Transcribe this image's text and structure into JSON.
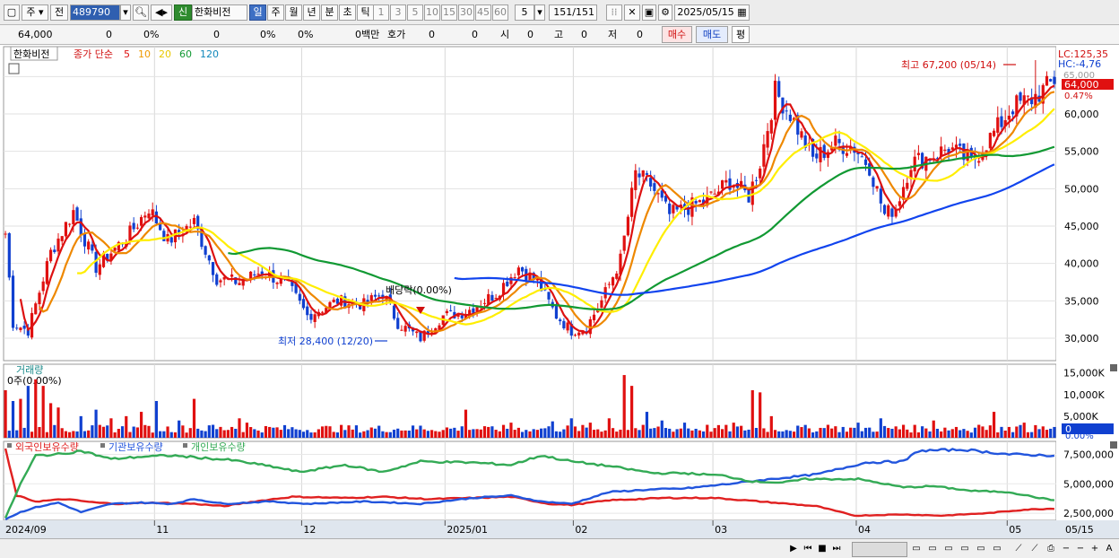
{
  "toolbar": {
    "period_week": "주",
    "prev": "전",
    "code": "489790",
    "credit": "신",
    "stock_name": "한화비전",
    "tabs": [
      "일",
      "주",
      "월",
      "년",
      "분",
      "초",
      "틱"
    ],
    "active_tab": "일",
    "intervals": [
      "1",
      "3",
      "5",
      "10",
      "15",
      "30",
      "45",
      "60"
    ],
    "count": "5",
    "range": "151",
    "range_total": "/151",
    "date": "2025/05/15"
  },
  "quote": {
    "price": "64,000",
    "change": "0",
    "change_pct": "0%",
    "volume": "0",
    "v2": "0%",
    "v3": "0%",
    "amount": "0백만",
    "hoga_label": "호가",
    "hoga_val": "0",
    "hoga_val2": "0",
    "si_label": "시",
    "si_val": "0",
    "go_label": "고",
    "go_val": "0",
    "jeo_label": "저",
    "jeo_val": "0",
    "buy": "매수",
    "sell": "매도",
    "pyeong": "평"
  },
  "chart_data": [
    {
      "type": "candlestick",
      "title": "한화비전",
      "legend_prefix": "종가 단순",
      "ma_periods": [
        5,
        10,
        20,
        60,
        120
      ],
      "ma_colors": [
        "#dd1111",
        "#ee8800",
        "#ffee00",
        "#119933",
        "#1144ee"
      ],
      "ma_legend_colors": [
        "#dd1111",
        "#ee9900",
        "#e8c800",
        "#119933",
        "#1188bb"
      ],
      "ylim": [
        27000,
        69000
      ],
      "yticks": [
        "30,000",
        "35,000",
        "40,000",
        "45,000",
        "50,000",
        "55,000",
        "60,000",
        "65,000"
      ],
      "ytick_values": [
        30000,
        35000,
        40000,
        45000,
        50000,
        55000,
        60000,
        65000
      ],
      "x_labels": [
        "2024/09",
        "11",
        "12",
        "2025/01",
        "02",
        "03",
        "04",
        "05",
        "05/15"
      ],
      "x_label_index": [
        0,
        40,
        79,
        117,
        151,
        188,
        226,
        266,
        289
      ],
      "n_bars": 279,
      "close_path": [
        [
          0,
          44000
        ],
        [
          2,
          32000
        ],
        [
          6,
          31000
        ],
        [
          12,
          41500
        ],
        [
          18,
          47000
        ],
        [
          24,
          39500
        ],
        [
          28,
          41500
        ],
        [
          33,
          44000
        ],
        [
          38,
          47500
        ],
        [
          43,
          43000
        ],
        [
          50,
          45500
        ],
        [
          56,
          38000
        ],
        [
          62,
          37500
        ],
        [
          68,
          39000
        ],
        [
          75,
          37000
        ],
        [
          80,
          33000
        ],
        [
          88,
          35000
        ],
        [
          95,
          34500
        ],
        [
          100,
          36000
        ],
        [
          104,
          32000
        ],
        [
          110,
          30000
        ],
        [
          116,
          33000
        ],
        [
          122,
          33500
        ],
        [
          130,
          36000
        ],
        [
          136,
          39500
        ],
        [
          141,
          37500
        ],
        [
          146,
          33000
        ],
        [
          150,
          31000
        ],
        [
          154,
          31500
        ],
        [
          158,
          35000
        ],
        [
          163,
          40500
        ],
        [
          167,
          52000
        ],
        [
          171,
          50500
        ],
        [
          176,
          46500
        ],
        [
          181,
          47500
        ],
        [
          186,
          48500
        ],
        [
          192,
          51000
        ],
        [
          197,
          49000
        ],
        [
          200,
          53500
        ],
        [
          204,
          63000
        ],
        [
          208,
          60000
        ],
        [
          214,
          54000
        ],
        [
          220,
          56000
        ],
        [
          225,
          55500
        ],
        [
          229,
          53000
        ],
        [
          233,
          46500
        ],
        [
          236,
          47500
        ],
        [
          240,
          53500
        ],
        [
          246,
          54500
        ],
        [
          250,
          55500
        ],
        [
          256,
          53500
        ],
        [
          262,
          57500
        ],
        [
          267,
          61000
        ],
        [
          272,
          62000
        ],
        [
          277,
          64000
        ],
        [
          278,
          64000
        ]
      ],
      "last_close": 64000,
      "high": {
        "label": "최고 67,200 (05/14)",
        "value": 67200
      },
      "low": {
        "label": "최저 28,400 (12/20)",
        "value": 28400
      },
      "event": {
        "label": "배당락(0.00%)"
      },
      "right_labels": {
        "lc": "LC:125,35",
        "hc": "HC:-4,76",
        "top": "65,000",
        "price": "64,000",
        "pct": "0.47%"
      }
    },
    {
      "type": "bar",
      "title": "거래량",
      "subtitle": "0주(0.00%)",
      "yticks": [
        "15,000K",
        "10,000K",
        "5,000K",
        "0"
      ],
      "ytick_values": [
        15000,
        10000,
        5000,
        0
      ],
      "bottom_label": "0.00%",
      "ylim": [
        0,
        17000
      ],
      "unit": "K",
      "spikes": [
        [
          0,
          11000
        ],
        [
          2,
          8500
        ],
        [
          4,
          9000
        ],
        [
          6,
          12000
        ],
        [
          8,
          13500
        ],
        [
          10,
          12000
        ],
        [
          12,
          8000
        ],
        [
          14,
          7000
        ],
        [
          20,
          5000
        ],
        [
          24,
          6500
        ],
        [
          28,
          4500
        ],
        [
          32,
          5000
        ],
        [
          36,
          6000
        ],
        [
          40,
          8500
        ],
        [
          46,
          4000
        ],
        [
          50,
          9000
        ],
        [
          55,
          3000
        ],
        [
          60,
          2500
        ],
        [
          62,
          4500
        ],
        [
          64,
          3500
        ],
        [
          70,
          2500
        ],
        [
          75,
          2000
        ],
        [
          80,
          1800
        ],
        [
          95,
          1500
        ],
        [
          100,
          1500
        ],
        [
          110,
          2800
        ],
        [
          116,
          1800
        ],
        [
          122,
          6500
        ],
        [
          128,
          2500
        ],
        [
          134,
          3500
        ],
        [
          140,
          2000
        ],
        [
          145,
          3800
        ],
        [
          150,
          4500
        ],
        [
          155,
          3500
        ],
        [
          160,
          4500
        ],
        [
          164,
          14500
        ],
        [
          166,
          12000
        ],
        [
          170,
          6000
        ],
        [
          174,
          4000
        ],
        [
          180,
          3500
        ],
        [
          186,
          3000
        ],
        [
          193,
          3500
        ],
        [
          198,
          11000
        ],
        [
          200,
          10500
        ],
        [
          203,
          5000
        ],
        [
          210,
          2800
        ],
        [
          218,
          3000
        ],
        [
          226,
          3500
        ],
        [
          232,
          4500
        ],
        [
          238,
          3000
        ],
        [
          246,
          4000
        ],
        [
          252,
          2500
        ],
        [
          258,
          3000
        ],
        [
          262,
          6000
        ],
        [
          266,
          2500
        ],
        [
          270,
          3500
        ],
        [
          274,
          2000
        ],
        [
          278,
          2500
        ]
      ]
    },
    {
      "type": "line",
      "title": "외국인보유수량",
      "series": [
        {
          "name": "외국인보유수량",
          "color": "#e02020",
          "values": [
            [
              0,
              7900000
            ],
            [
              3,
              4000000
            ],
            [
              8,
              3500000
            ],
            [
              16,
              3700000
            ],
            [
              24,
              3400000
            ],
            [
              30,
              3300000
            ],
            [
              38,
              3400000
            ],
            [
              50,
              3300000
            ],
            [
              58,
              3100000
            ],
            [
              66,
              3500000
            ],
            [
              76,
              3900000
            ],
            [
              90,
              3800000
            ],
            [
              100,
              3900000
            ],
            [
              112,
              3700000
            ],
            [
              124,
              3800000
            ],
            [
              134,
              3900000
            ],
            [
              144,
              3300000
            ],
            [
              150,
              3200000
            ],
            [
              160,
              3600000
            ],
            [
              175,
              3800000
            ],
            [
              188,
              3800000
            ],
            [
              200,
              3500000
            ],
            [
              215,
              3100000
            ],
            [
              225,
              2300000
            ],
            [
              238,
              2400000
            ],
            [
              248,
              2300000
            ],
            [
              260,
              2500000
            ],
            [
              270,
              2800000
            ],
            [
              278,
              2900000
            ]
          ]
        },
        {
          "name": "기관보유수량",
          "color": "#2255dd",
          "values": [
            [
              0,
              2000000
            ],
            [
              4,
              2600000
            ],
            [
              8,
              3000000
            ],
            [
              14,
              3400000
            ],
            [
              20,
              2600000
            ],
            [
              28,
              3300000
            ],
            [
              36,
              3400000
            ],
            [
              44,
              3300000
            ],
            [
              50,
              3700000
            ],
            [
              58,
              3300000
            ],
            [
              70,
              3500000
            ],
            [
              80,
              3300000
            ],
            [
              95,
              3500000
            ],
            [
              110,
              3300000
            ],
            [
              124,
              3800000
            ],
            [
              134,
              4000000
            ],
            [
              142,
              3500000
            ],
            [
              150,
              3300000
            ],
            [
              160,
              4300000
            ],
            [
              170,
              4500000
            ],
            [
              180,
              4600000
            ],
            [
              192,
              5000000
            ],
            [
              200,
              5300000
            ],
            [
              215,
              5800000
            ],
            [
              228,
              6800000
            ],
            [
              238,
              6900000
            ],
            [
              242,
              7800000
            ],
            [
              254,
              7900000
            ],
            [
              266,
              7500000
            ],
            [
              278,
              7400000
            ]
          ]
        },
        {
          "name": "개인보유수량",
          "color": "#33aa55",
          "values": [
            [
              0,
              2100000
            ],
            [
              4,
              5000000
            ],
            [
              8,
              7400000
            ],
            [
              14,
              7500000
            ],
            [
              20,
              7800000
            ],
            [
              28,
              7100000
            ],
            [
              36,
              7300000
            ],
            [
              44,
              7400000
            ],
            [
              52,
              7200000
            ],
            [
              60,
              7000000
            ],
            [
              70,
              6500000
            ],
            [
              78,
              6000000
            ],
            [
              90,
              6600000
            ],
            [
              100,
              6000000
            ],
            [
              110,
              6900000
            ],
            [
              124,
              6800000
            ],
            [
              134,
              6600000
            ],
            [
              142,
              7400000
            ],
            [
              150,
              6900000
            ],
            [
              160,
              6500000
            ],
            [
              172,
              5900000
            ],
            [
              180,
              5900000
            ],
            [
              190,
              5700000
            ],
            [
              198,
              5200000
            ],
            [
              206,
              5100000
            ],
            [
              212,
              5400000
            ],
            [
              226,
              5400000
            ],
            [
              238,
              4700000
            ],
            [
              246,
              4800000
            ],
            [
              256,
              4400000
            ],
            [
              266,
              4300000
            ],
            [
              274,
              3800000
            ],
            [
              278,
              3600000
            ]
          ]
        }
      ],
      "yticks": [
        "7,500,000",
        "5,000,000",
        "2,500,000"
      ],
      "ytick_values": [
        7500000,
        5000000,
        2500000
      ],
      "ylim": [
        1900000,
        8600000
      ]
    }
  ]
}
